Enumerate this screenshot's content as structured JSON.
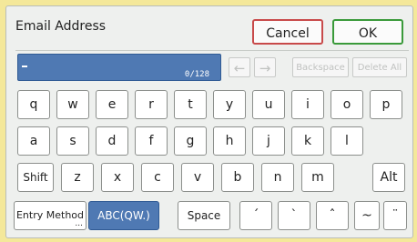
{
  "dialog": {
    "title": "Email Address",
    "cancel_label": "Cancel",
    "ok_label": "OK"
  },
  "input": {
    "value": "",
    "counter": "0/128"
  },
  "edit": {
    "left_arrow": "←",
    "right_arrow": "→",
    "backspace_label": "Backspace",
    "delete_all_label": "Delete All"
  },
  "keys": {
    "row1": [
      "q",
      "w",
      "e",
      "r",
      "t",
      "y",
      "u",
      "i",
      "o",
      "p"
    ],
    "row2": [
      "a",
      "s",
      "d",
      "f",
      "g",
      "h",
      "j",
      "k",
      "l"
    ],
    "row3": [
      "z",
      "x",
      "c",
      "v",
      "b",
      "n",
      "m"
    ],
    "shift_label": "Shift",
    "alt_label": "Alt",
    "entry_method_label": "Entry Method",
    "entry_method_dots": "...",
    "mode_label": "ABC(QW.)",
    "space_label": "Space",
    "accent_keys": [
      "´",
      "`",
      "ˆ",
      "~",
      "¨"
    ]
  },
  "colors": {
    "background": "#f4e89a",
    "input_active": "#4f79b3",
    "cancel_border": "#c84a4a",
    "ok_border": "#3a9a3a"
  }
}
